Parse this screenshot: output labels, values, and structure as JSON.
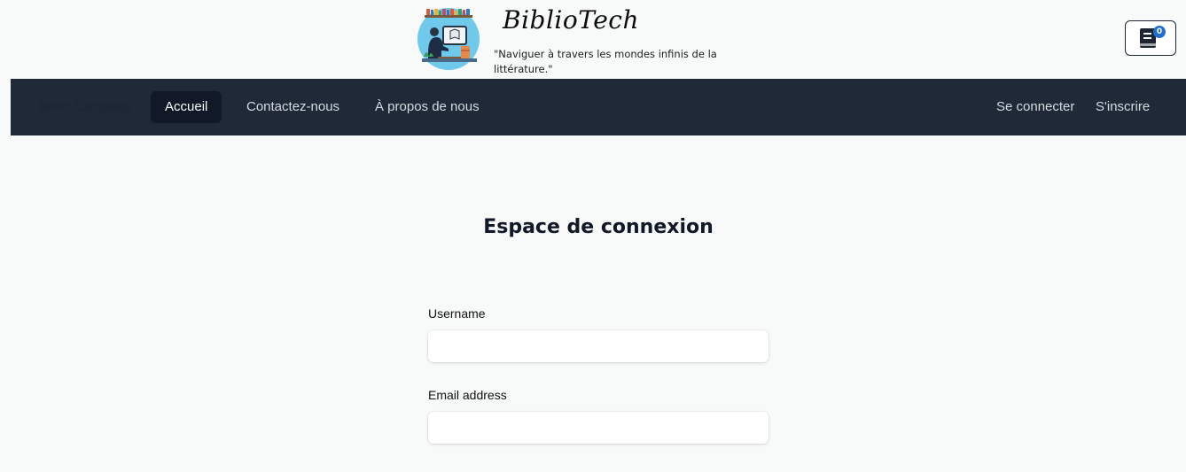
{
  "header": {
    "brand": "BiblioTech",
    "tagline": "\"Naviguer à travers les mondes infinis de la littérature.\"",
    "cart_count": "0",
    "cart_icon": "book-cart-icon",
    "logo_icon": "reading-person-logo"
  },
  "navbar": {
    "brand": "Book Company",
    "links": [
      {
        "label": "Accueil",
        "active": true
      },
      {
        "label": "Contactez-nous",
        "active": false
      },
      {
        "label": "À propos de nous",
        "active": false
      }
    ],
    "right_links": [
      {
        "label": "Se connecter"
      },
      {
        "label": "S'inscrire"
      }
    ]
  },
  "main": {
    "title": "Espace de connexion",
    "fields": [
      {
        "label": "Username",
        "value": "",
        "placeholder": ""
      },
      {
        "label": "Email address",
        "value": "",
        "placeholder": ""
      }
    ]
  },
  "colors": {
    "navbar_bg": "#1f2937",
    "active_link_bg": "#111827",
    "page_bg": "#f8fafa",
    "badge": "#1f6fd1"
  }
}
